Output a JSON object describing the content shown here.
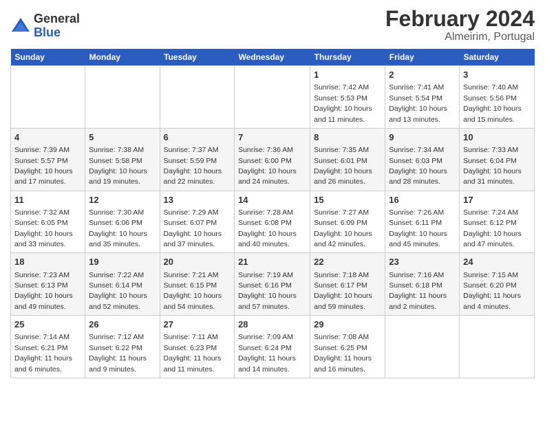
{
  "header": {
    "logo_general": "General",
    "logo_blue": "Blue",
    "title": "February 2024",
    "subtitle": "Almeirim, Portugal"
  },
  "weekdays": [
    "Sunday",
    "Monday",
    "Tuesday",
    "Wednesday",
    "Thursday",
    "Friday",
    "Saturday"
  ],
  "weeks": [
    [
      {
        "day": "",
        "info": ""
      },
      {
        "day": "",
        "info": ""
      },
      {
        "day": "",
        "info": ""
      },
      {
        "day": "",
        "info": ""
      },
      {
        "day": "1",
        "info": "Sunrise: 7:42 AM\nSunset: 5:53 PM\nDaylight: 10 hours\nand 11 minutes."
      },
      {
        "day": "2",
        "info": "Sunrise: 7:41 AM\nSunset: 5:54 PM\nDaylight: 10 hours\nand 13 minutes."
      },
      {
        "day": "3",
        "info": "Sunrise: 7:40 AM\nSunset: 5:56 PM\nDaylight: 10 hours\nand 15 minutes."
      }
    ],
    [
      {
        "day": "4",
        "info": "Sunrise: 7:39 AM\nSunset: 5:57 PM\nDaylight: 10 hours\nand 17 minutes."
      },
      {
        "day": "5",
        "info": "Sunrise: 7:38 AM\nSunset: 5:58 PM\nDaylight: 10 hours\nand 19 minutes."
      },
      {
        "day": "6",
        "info": "Sunrise: 7:37 AM\nSunset: 5:59 PM\nDaylight: 10 hours\nand 22 minutes."
      },
      {
        "day": "7",
        "info": "Sunrise: 7:36 AM\nSunset: 6:00 PM\nDaylight: 10 hours\nand 24 minutes."
      },
      {
        "day": "8",
        "info": "Sunrise: 7:35 AM\nSunset: 6:01 PM\nDaylight: 10 hours\nand 26 minutes."
      },
      {
        "day": "9",
        "info": "Sunrise: 7:34 AM\nSunset: 6:03 PM\nDaylight: 10 hours\nand 28 minutes."
      },
      {
        "day": "10",
        "info": "Sunrise: 7:33 AM\nSunset: 6:04 PM\nDaylight: 10 hours\nand 31 minutes."
      }
    ],
    [
      {
        "day": "11",
        "info": "Sunrise: 7:32 AM\nSunset: 6:05 PM\nDaylight: 10 hours\nand 33 minutes."
      },
      {
        "day": "12",
        "info": "Sunrise: 7:30 AM\nSunset: 6:06 PM\nDaylight: 10 hours\nand 35 minutes."
      },
      {
        "day": "13",
        "info": "Sunrise: 7:29 AM\nSunset: 6:07 PM\nDaylight: 10 hours\nand 37 minutes."
      },
      {
        "day": "14",
        "info": "Sunrise: 7:28 AM\nSunset: 6:08 PM\nDaylight: 10 hours\nand 40 minutes."
      },
      {
        "day": "15",
        "info": "Sunrise: 7:27 AM\nSunset: 6:09 PM\nDaylight: 10 hours\nand 42 minutes."
      },
      {
        "day": "16",
        "info": "Sunrise: 7:26 AM\nSunset: 6:11 PM\nDaylight: 10 hours\nand 45 minutes."
      },
      {
        "day": "17",
        "info": "Sunrise: 7:24 AM\nSunset: 6:12 PM\nDaylight: 10 hours\nand 47 minutes."
      }
    ],
    [
      {
        "day": "18",
        "info": "Sunrise: 7:23 AM\nSunset: 6:13 PM\nDaylight: 10 hours\nand 49 minutes."
      },
      {
        "day": "19",
        "info": "Sunrise: 7:22 AM\nSunset: 6:14 PM\nDaylight: 10 hours\nand 52 minutes."
      },
      {
        "day": "20",
        "info": "Sunrise: 7:21 AM\nSunset: 6:15 PM\nDaylight: 10 hours\nand 54 minutes."
      },
      {
        "day": "21",
        "info": "Sunrise: 7:19 AM\nSunset: 6:16 PM\nDaylight: 10 hours\nand 57 minutes."
      },
      {
        "day": "22",
        "info": "Sunrise: 7:18 AM\nSunset: 6:17 PM\nDaylight: 10 hours\nand 59 minutes."
      },
      {
        "day": "23",
        "info": "Sunrise: 7:16 AM\nSunset: 6:18 PM\nDaylight: 11 hours\nand 2 minutes."
      },
      {
        "day": "24",
        "info": "Sunrise: 7:15 AM\nSunset: 6:20 PM\nDaylight: 11 hours\nand 4 minutes."
      }
    ],
    [
      {
        "day": "25",
        "info": "Sunrise: 7:14 AM\nSunset: 6:21 PM\nDaylight: 11 hours\nand 6 minutes."
      },
      {
        "day": "26",
        "info": "Sunrise: 7:12 AM\nSunset: 6:22 PM\nDaylight: 11 hours\nand 9 minutes."
      },
      {
        "day": "27",
        "info": "Sunrise: 7:11 AM\nSunset: 6:23 PM\nDaylight: 11 hours\nand 11 minutes."
      },
      {
        "day": "28",
        "info": "Sunrise: 7:09 AM\nSunset: 6:24 PM\nDaylight: 11 hours\nand 14 minutes."
      },
      {
        "day": "29",
        "info": "Sunrise: 7:08 AM\nSunset: 6:25 PM\nDaylight: 11 hours\nand 16 minutes."
      },
      {
        "day": "",
        "info": ""
      },
      {
        "day": "",
        "info": ""
      }
    ]
  ]
}
